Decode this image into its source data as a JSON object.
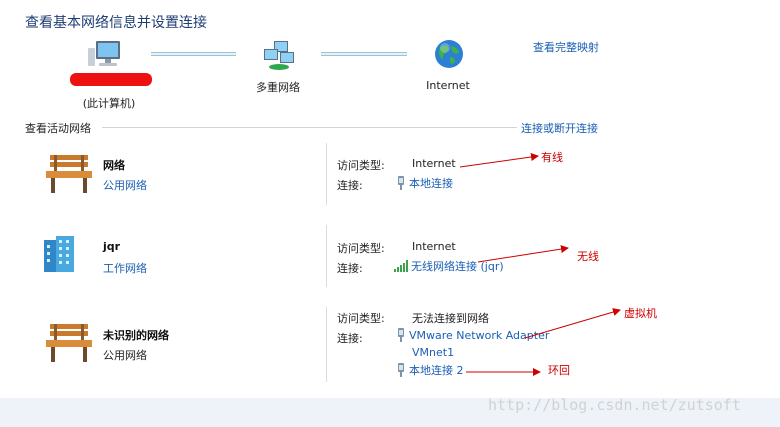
{
  "header": {
    "title": "查看基本网络信息并设置连接",
    "view_full_map_link": "查看完整映射"
  },
  "network_map": {
    "nodes": [
      {
        "label": "(此计算机)",
        "icon": "computer-icon"
      },
      {
        "label": "多重网络",
        "icon": "multiple-networks-icon"
      },
      {
        "label": "Internet",
        "icon": "globe-icon"
      }
    ]
  },
  "active_networks": {
    "title": "查看活动网络",
    "connect_link": "连接或断开连接",
    "access_type_label": "访问类型:",
    "connections_label": "连接:",
    "networks": [
      {
        "name": "网络",
        "category": "公用网络",
        "icon": "bench-icon",
        "access_type": "Internet",
        "connections": [
          {
            "name": "本地连接",
            "icon": "ethernet-icon"
          }
        ],
        "annotation": "有线"
      },
      {
        "name": "jqr",
        "category": "工作网络",
        "icon": "building-icon",
        "access_type": "Internet",
        "connections": [
          {
            "name": "无线网络连接 (jqr)",
            "icon": "wifi-signal-icon"
          }
        ],
        "annotation": "无线"
      },
      {
        "name": "未识别的网络",
        "category": "公用网络",
        "icon": "bench-icon",
        "access_type": "无法连接到网络",
        "connections": [
          {
            "name": "VMware Network Adapter",
            "name_cont": "VMnet1",
            "icon": "ethernet-icon"
          },
          {
            "name": "本地连接 2",
            "icon": "ethernet-icon"
          }
        ],
        "annotations": [
          "虚拟机",
          "环回"
        ]
      }
    ]
  },
  "watermark": "http://blog.csdn.net/zutsoft",
  "colors": {
    "accent": "#1a5fb4",
    "title": "#1e3d73",
    "annotation": "#cc0000"
  }
}
